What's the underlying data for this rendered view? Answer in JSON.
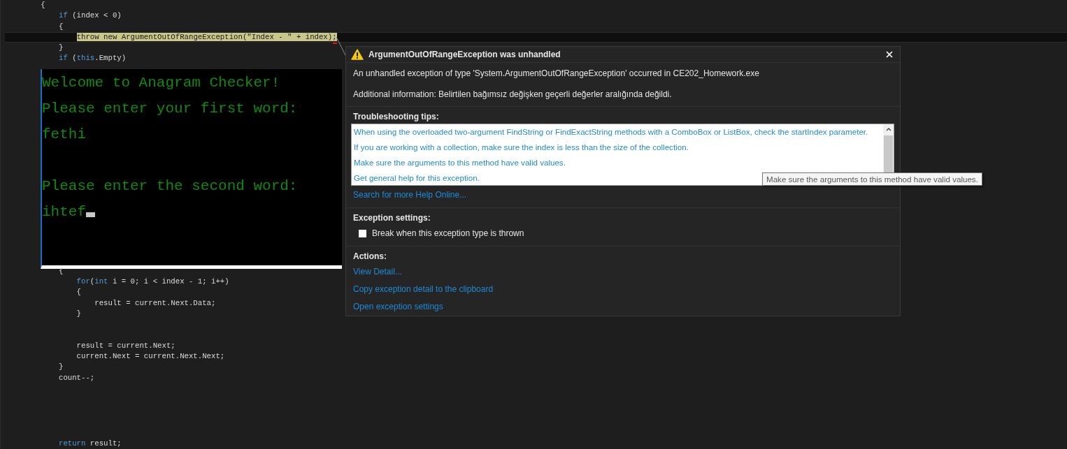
{
  "editor": {
    "lines_above": [
      {
        "current": false,
        "tokens": [
          {
            "text": "        {",
            "kind": "plain"
          }
        ]
      },
      {
        "current": false,
        "tokens": [
          {
            "text": "            if",
            "kind": "keyword"
          },
          {
            "text": " (index < 0)",
            "kind": "plain"
          }
        ]
      },
      {
        "current": false,
        "tokens": [
          {
            "text": "            {",
            "kind": "plain"
          }
        ]
      },
      {
        "current": true,
        "tokens": [
          {
            "text": "                throw new ArgumentOutOfRangeException(\"Index - \" + index);",
            "kind": "highlighted"
          }
        ]
      },
      {
        "current": false,
        "tokens": [
          {
            "text": "            }",
            "kind": "plain"
          }
        ]
      },
      {
        "current": false,
        "tokens": [
          {
            "text": "            if",
            "kind": "keyword"
          },
          {
            "text": " (",
            "kind": "plain"
          },
          {
            "text": "this",
            "kind": "keyword"
          },
          {
            "text": ".Empty)",
            "kind": "plain"
          }
        ]
      }
    ],
    "console": {
      "lines": [
        {
          "kind": "text",
          "text": "Welcome to Anagram Checker!",
          "cursor": false
        },
        {
          "kind": "text",
          "text": "Please enter your first word:",
          "cursor": false
        },
        {
          "kind": "text",
          "text": "fethi",
          "cursor": false
        },
        {
          "kind": "blank"
        },
        {
          "kind": "text",
          "text": "Please enter the second word:",
          "cursor": false
        },
        {
          "kind": "text",
          "text": "ihtef",
          "cursor": true
        }
      ]
    },
    "lines_below": [
      {
        "kind": "code",
        "current": false,
        "tokens": [
          {
            "text": "            {",
            "kind": "plain"
          }
        ]
      },
      {
        "kind": "code",
        "current": false,
        "tokens": [
          {
            "text": "                for",
            "kind": "keyword"
          },
          {
            "text": "(",
            "kind": "plain"
          },
          {
            "text": "int",
            "kind": "keyword"
          },
          {
            "text": " i = 0; i < index - 1; i++)",
            "kind": "plain"
          }
        ]
      },
      {
        "kind": "code",
        "current": false,
        "tokens": [
          {
            "text": "                {",
            "kind": "plain"
          }
        ]
      },
      {
        "kind": "code",
        "current": false,
        "tokens": [
          {
            "text": "                    result = current.Next.Data;",
            "kind": "plain"
          }
        ]
      },
      {
        "kind": "code",
        "current": false,
        "tokens": [
          {
            "text": "                }",
            "kind": "plain"
          }
        ]
      },
      {
        "kind": "blank"
      },
      {
        "kind": "blank"
      },
      {
        "kind": "code",
        "current": false,
        "tokens": [
          {
            "text": "                result = current.Next;",
            "kind": "plain"
          }
        ]
      },
      {
        "kind": "code",
        "current": false,
        "tokens": [
          {
            "text": "                current.Next = current.Next.Next;",
            "kind": "plain"
          }
        ]
      },
      {
        "kind": "code",
        "current": false,
        "tokens": [
          {
            "text": "            }",
            "kind": "plain"
          }
        ]
      },
      {
        "kind": "code",
        "current": false,
        "tokens": [
          {
            "text": "            count--;",
            "kind": "plain"
          }
        ]
      }
    ],
    "last_line": {
      "current": false,
      "tokens": [
        {
          "text": "            return",
          "kind": "keyword"
        },
        {
          "text": " result;",
          "kind": "plain"
        }
      ]
    }
  },
  "exception_popup": {
    "title": "ArgumentOutOfRangeException was unhandled",
    "message": "An unhandled exception of type 'System.ArgumentOutOfRangeException' occurred in CE202_Homework.exe",
    "additional_info": "Additional information: Belirtilen bağımsız değişken geçerli değerler aralığında değildi.",
    "tips_heading": "Troubleshooting tips:",
    "tips": [
      "When using the overloaded two-argument FindString or FindExactString methods with a ComboBox or ListBox, check the startIndex parameter.",
      "If you are working with a collection, make sure the index is less than the size of the collection.",
      "Make sure the arguments to this method have valid values.",
      "Get general help for this exception."
    ],
    "search_link": "Search for more Help Online...",
    "settings_heading": "Exception settings:",
    "settings": [
      {
        "label": "Break when this exception type is thrown",
        "checked": false
      }
    ],
    "actions_heading": "Actions:",
    "actions": [
      "View Detail...",
      "Copy exception detail to the clipboard",
      "Open exception settings"
    ]
  },
  "tooltip": {
    "text": "Make sure the arguments to this method have valid values."
  }
}
